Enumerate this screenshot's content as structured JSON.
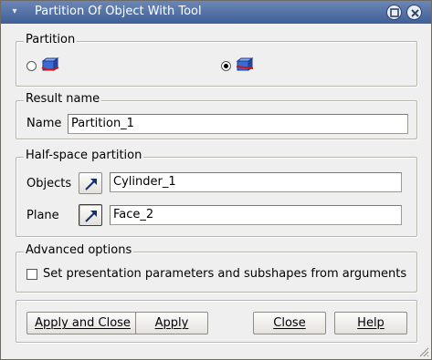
{
  "window": {
    "title": "Partition Of Object With Tool",
    "menu_icon": "window-menu-icon",
    "controls": [
      "minimize-icon",
      "close-icon"
    ]
  },
  "partition": {
    "legend": "Partition",
    "options": [
      {
        "icon": "partition-object-icon",
        "selected": false
      },
      {
        "icon": "partition-halfspace-icon",
        "selected": true
      }
    ]
  },
  "result": {
    "legend": "Result name",
    "name_label": "Name",
    "name_value": "Partition_1"
  },
  "halfspace": {
    "legend": "Half-space partition",
    "objects_label": "Objects",
    "objects_value": "Cylinder_1",
    "plane_label": "Plane",
    "plane_value": "Face_2",
    "select_icon": "arrow-select-icon"
  },
  "advanced": {
    "legend": "Advanced options",
    "checkbox_label": "Set presentation parameters and subshapes from arguments",
    "checked": false
  },
  "buttons": {
    "apply_close": "Apply and Close",
    "apply": "Apply",
    "close": "Close",
    "help": "Help"
  },
  "colors": {
    "titlebar": "#4a6aa3",
    "dialog_bg": "#efefef",
    "icon_blue": "#2c57c8",
    "icon_red": "#d01414"
  }
}
